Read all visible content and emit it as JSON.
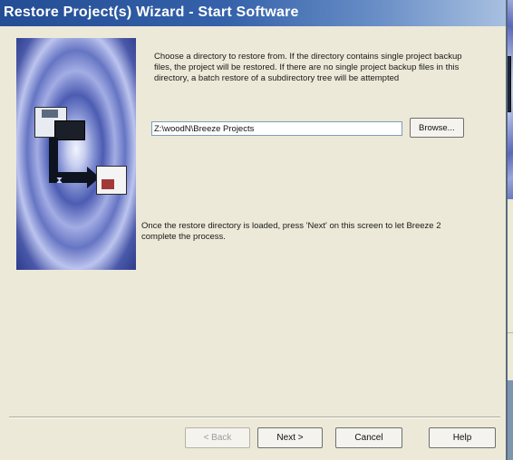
{
  "window": {
    "title": "Restore Project(s) Wizard - Start Software"
  },
  "content": {
    "description": "Choose a directory to restore from. If the directory contains single project backup files, the project will be restored. If there are no single project backup files in this directory, a batch restore of a subdirectory tree will be attempted",
    "directory_value": "Z:\\woodN\\Breeze Projects",
    "browse_label": "Browse...",
    "note": "Once the restore directory is loaded, press 'Next' on this screen to let Breeze 2 complete the process."
  },
  "buttons": {
    "back": "< Back",
    "next": "Next >",
    "cancel": "Cancel",
    "help": "Help"
  },
  "icons": {
    "art": "restore-illustration",
    "disk_top": "floppy-disk-icon",
    "device": "server-icon",
    "hourglass": "hourglass-icon",
    "disk_bottom": "floppy-disk-icon"
  },
  "colors": {
    "title_bar": "#234d94",
    "window_bg": "#ece9d8",
    "art_blue": "#4c5cb2"
  }
}
